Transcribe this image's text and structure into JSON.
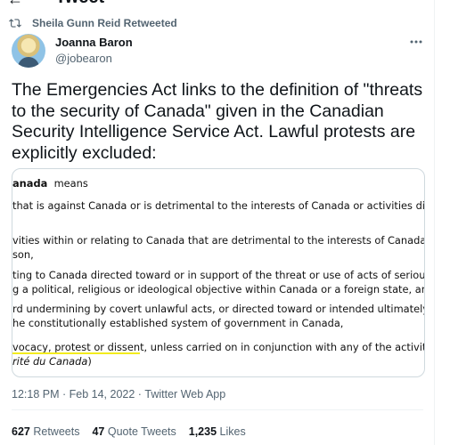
{
  "header": {
    "back_icon": "arrow-left-icon",
    "title": "Tweet"
  },
  "retweet": {
    "icon": "retweet-icon",
    "label": "Sheila Gunn Reid Retweeted"
  },
  "author": {
    "name": "Joanna Baron",
    "handle": "@jobearon",
    "avatar_icon": "avatar-image"
  },
  "more_icon": "more-horizontal-icon",
  "tweet": {
    "text": "The Emergencies Act links to the definition of \"threats to the security of Canada\" given in the Canadian Security Intelligence Service Act. Lawful protests are explicitly excluded:"
  },
  "media": {
    "term": "anada",
    "term_suffix": "  means",
    "lines": [
      "that is against Canada or is detrimental to the interests of Canada or activities directed",
      "vities within or relating to Canada that are detrimental to the interests of Canada and ar",
      "son,",
      "ting to Canada directed toward or in support of the threat or use of acts of serious violen",
      "g a political, religious or ideological objective within Canada or a foreign state, and",
      "rd undermining by covert unlawful acts, or directed toward or intended ultimately to lea",
      "he constitutionally established system of government in Canada,",
      "vocacy, protest or dissent, unless carried on in conjunction with any of the activities refe"
    ],
    "italic_line": "rité du Canada",
    "italic_close": ")",
    "highlight_color": "#f2ec1d"
  },
  "timestamp": {
    "time": "12:18 PM",
    "sep": " · ",
    "date": "Feb 14, 2022",
    "sep2": " · ",
    "source": "Twitter Web App"
  },
  "stats": {
    "retweets_count": "627",
    "retweets_label": "Retweets",
    "quote_count": "47",
    "quote_label": "Quote Tweets",
    "likes_count": "1,235",
    "likes_label": "Likes"
  }
}
